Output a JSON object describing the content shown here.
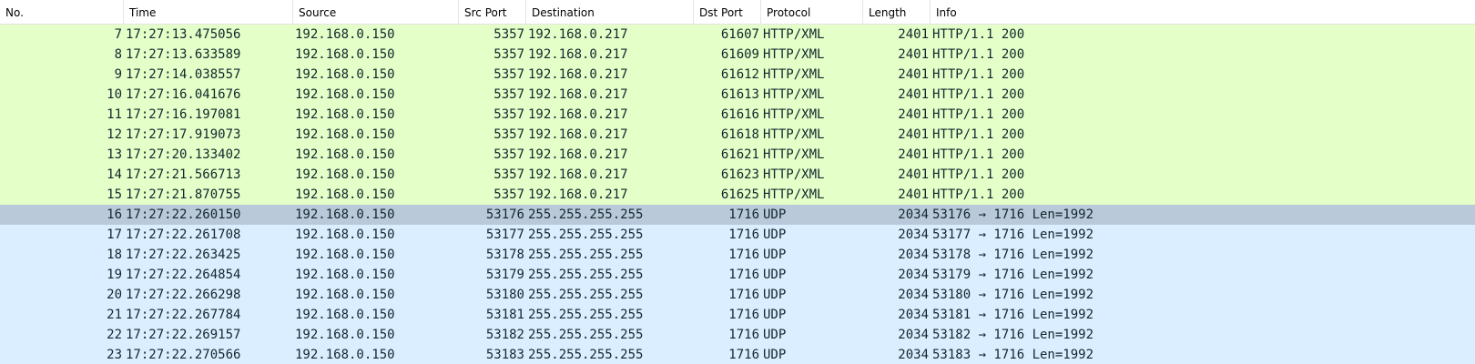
{
  "columns": {
    "no": "No.",
    "time": "Time",
    "source": "Source",
    "src_port": "Src Port",
    "destination": "Destination",
    "dst_port": "Dst Port",
    "protocol": "Protocol",
    "length": "Length",
    "info": "Info"
  },
  "colors": {
    "http_row": "#e4ffc7",
    "udp_row": "#daeeff",
    "selected_row": "#b9c9d9",
    "text": "#12272e"
  },
  "selected_packet": "16",
  "packets": [
    {
      "no": "7",
      "time": "17:27:13.475056",
      "source": "192.168.0.150",
      "src_port": "5357",
      "destination": "192.168.0.217",
      "dst_port": "61607",
      "protocol": "HTTP/XML",
      "length": "2401",
      "info": "HTTP/1.1 200"
    },
    {
      "no": "8",
      "time": "17:27:13.633589",
      "source": "192.168.0.150",
      "src_port": "5357",
      "destination": "192.168.0.217",
      "dst_port": "61609",
      "protocol": "HTTP/XML",
      "length": "2401",
      "info": "HTTP/1.1 200"
    },
    {
      "no": "9",
      "time": "17:27:14.038557",
      "source": "192.168.0.150",
      "src_port": "5357",
      "destination": "192.168.0.217",
      "dst_port": "61612",
      "protocol": "HTTP/XML",
      "length": "2401",
      "info": "HTTP/1.1 200"
    },
    {
      "no": "10",
      "time": "17:27:16.041676",
      "source": "192.168.0.150",
      "src_port": "5357",
      "destination": "192.168.0.217",
      "dst_port": "61613",
      "protocol": "HTTP/XML",
      "length": "2401",
      "info": "HTTP/1.1 200"
    },
    {
      "no": "11",
      "time": "17:27:16.197081",
      "source": "192.168.0.150",
      "src_port": "5357",
      "destination": "192.168.0.217",
      "dst_port": "61616",
      "protocol": "HTTP/XML",
      "length": "2401",
      "info": "HTTP/1.1 200"
    },
    {
      "no": "12",
      "time": "17:27:17.919073",
      "source": "192.168.0.150",
      "src_port": "5357",
      "destination": "192.168.0.217",
      "dst_port": "61618",
      "protocol": "HTTP/XML",
      "length": "2401",
      "info": "HTTP/1.1 200"
    },
    {
      "no": "13",
      "time": "17:27:20.133402",
      "source": "192.168.0.150",
      "src_port": "5357",
      "destination": "192.168.0.217",
      "dst_port": "61621",
      "protocol": "HTTP/XML",
      "length": "2401",
      "info": "HTTP/1.1 200"
    },
    {
      "no": "14",
      "time": "17:27:21.566713",
      "source": "192.168.0.150",
      "src_port": "5357",
      "destination": "192.168.0.217",
      "dst_port": "61623",
      "protocol": "HTTP/XML",
      "length": "2401",
      "info": "HTTP/1.1 200"
    },
    {
      "no": "15",
      "time": "17:27:21.870755",
      "source": "192.168.0.150",
      "src_port": "5357",
      "destination": "192.168.0.217",
      "dst_port": "61625",
      "protocol": "HTTP/XML",
      "length": "2401",
      "info": "HTTP/1.1 200"
    },
    {
      "no": "16",
      "time": "17:27:22.260150",
      "source": "192.168.0.150",
      "src_port": "53176",
      "destination": "255.255.255.255",
      "dst_port": "1716",
      "protocol": "UDP",
      "length": "2034",
      "info": "53176 → 1716 Len=1992"
    },
    {
      "no": "17",
      "time": "17:27:22.261708",
      "source": "192.168.0.150",
      "src_port": "53177",
      "destination": "255.255.255.255",
      "dst_port": "1716",
      "protocol": "UDP",
      "length": "2034",
      "info": "53177 → 1716 Len=1992"
    },
    {
      "no": "18",
      "time": "17:27:22.263425",
      "source": "192.168.0.150",
      "src_port": "53178",
      "destination": "255.255.255.255",
      "dst_port": "1716",
      "protocol": "UDP",
      "length": "2034",
      "info": "53178 → 1716 Len=1992"
    },
    {
      "no": "19",
      "time": "17:27:22.264854",
      "source": "192.168.0.150",
      "src_port": "53179",
      "destination": "255.255.255.255",
      "dst_port": "1716",
      "protocol": "UDP",
      "length": "2034",
      "info": "53179 → 1716 Len=1992"
    },
    {
      "no": "20",
      "time": "17:27:22.266298",
      "source": "192.168.0.150",
      "src_port": "53180",
      "destination": "255.255.255.255",
      "dst_port": "1716",
      "protocol": "UDP",
      "length": "2034",
      "info": "53180 → 1716 Len=1992"
    },
    {
      "no": "21",
      "time": "17:27:22.267784",
      "source": "192.168.0.150",
      "src_port": "53181",
      "destination": "255.255.255.255",
      "dst_port": "1716",
      "protocol": "UDP",
      "length": "2034",
      "info": "53181 → 1716 Len=1992"
    },
    {
      "no": "22",
      "time": "17:27:22.269157",
      "source": "192.168.0.150",
      "src_port": "53182",
      "destination": "255.255.255.255",
      "dst_port": "1716",
      "protocol": "UDP",
      "length": "2034",
      "info": "53182 → 1716 Len=1992"
    },
    {
      "no": "23",
      "time": "17:27:22.270566",
      "source": "192.168.0.150",
      "src_port": "53183",
      "destination": "255.255.255.255",
      "dst_port": "1716",
      "protocol": "UDP",
      "length": "2034",
      "info": "53183 → 1716 Len=1992"
    }
  ]
}
